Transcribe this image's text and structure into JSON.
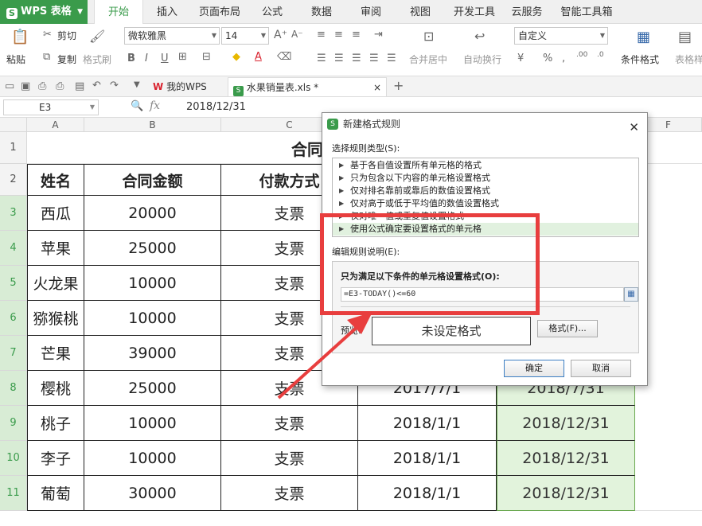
{
  "app": {
    "name": "WPS 表格",
    "logo": "S"
  },
  "tabs": [
    "开始",
    "插入",
    "页面布局",
    "公式",
    "数据",
    "审阅",
    "视图",
    "开发工具",
    "云服务",
    "智能工具箱"
  ],
  "ribbon": {
    "cut": "剪切",
    "paste": "粘贴",
    "copy": "复制",
    "format_painter": "格式刷",
    "font_name": "微软雅黑",
    "font_size": "14",
    "merge": "合并居中",
    "wrap": "自动换行",
    "number_format": "自定义",
    "cond_format": "条件格式",
    "table_style": "表格样"
  },
  "doc_tabs": {
    "home": "我的WPS",
    "file": "水果销量表.xls *"
  },
  "formula_bar": {
    "cell_ref": "E3",
    "fx": "fx",
    "value": "2018/12/31"
  },
  "sheet": {
    "columns": [
      "A",
      "B",
      "C",
      "D",
      "E",
      "F"
    ],
    "rows": [
      "1",
      "2",
      "3",
      "4",
      "5",
      "6",
      "7",
      "8",
      "9",
      "10",
      "11"
    ],
    "title": "合同",
    "headers": [
      "姓名",
      "合同金额",
      "付款方式"
    ],
    "data": [
      {
        "name": "西瓜",
        "amount": "20000",
        "pay": "支票"
      },
      {
        "name": "苹果",
        "amount": "25000",
        "pay": "支票"
      },
      {
        "name": "火龙果",
        "amount": "10000",
        "pay": "支票"
      },
      {
        "name": "猕猴桃",
        "amount": "10000",
        "pay": "支票"
      },
      {
        "name": "芒果",
        "amount": "39000",
        "pay": "支票"
      },
      {
        "name": "樱桃",
        "amount": "25000",
        "pay": "支票",
        "d": "2017/7/1",
        "e": "2018/7/31"
      },
      {
        "name": "桃子",
        "amount": "10000",
        "pay": "支票",
        "d": "2018/1/1",
        "e": "2018/12/31"
      },
      {
        "name": "李子",
        "amount": "10000",
        "pay": "支票",
        "d": "2018/1/1",
        "e": "2018/12/31"
      },
      {
        "name": "葡萄",
        "amount": "30000",
        "pay": "支票",
        "d": "2018/1/1",
        "e": "2018/12/31"
      }
    ]
  },
  "dialog": {
    "title": "新建格式规则",
    "select_type_label": "选择规则类型(S):",
    "rule_types": [
      "基于各自值设置所有单元格的格式",
      "只为包含以下内容的单元格设置格式",
      "仅对排名靠前或靠后的数值设置格式",
      "仅对高于或低于平均值的数值设置格式",
      "仅对唯一值或重复值设置格式",
      "使用公式确定要设置格式的单元格"
    ],
    "edit_label": "编辑规则说明(E):",
    "formula_label": "只为满足以下条件的单元格设置格式(O):",
    "formula": "=E3-TODAY()<=60",
    "preview_label": "预览:",
    "preview_text": "未设定格式",
    "format_button": "格式(F)...",
    "ok": "确定",
    "cancel": "取消"
  },
  "colors": {
    "brand": "#3a9b4b",
    "annotation": "#e83e3e",
    "highlight": "#e2f3dc"
  }
}
